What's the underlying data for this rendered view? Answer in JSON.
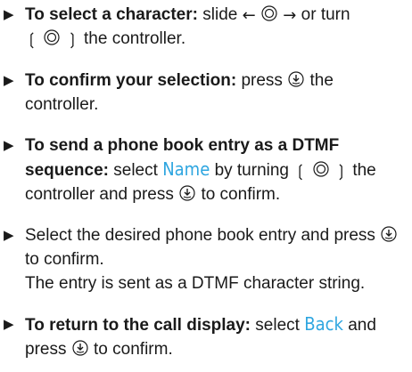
{
  "items": [
    {
      "bold": "To select a character:",
      "t1": "slide",
      "t2": "or turn",
      "t3": "the controller."
    },
    {
      "bold": "To confirm your selection:",
      "t1": "press",
      "t2": "the controller."
    },
    {
      "bold": "To send a phone book entry as a DTMF sequence:",
      "t1": "select",
      "disp": "Name",
      "t2": "by turning",
      "t3": "the controller and press",
      "t4": "to confirm."
    },
    {
      "t1": "Select the desired phone book entry and press",
      "t2": "to confirm.",
      "t3": "The entry is sent as a DTMF character string."
    },
    {
      "bold": "To return to the call display:",
      "t1": "select",
      "disp": "Back",
      "t2": "and press",
      "t3": "to confirm."
    }
  ],
  "icons": {
    "bullet": "right-pointing-triangle",
    "slide_left": "arrow-left",
    "slide_right": "arrow-right",
    "controller": "controller-ring",
    "turn_left": "turn-left-bracket",
    "turn_right": "turn-right-bracket",
    "press": "controller-press"
  },
  "colors": {
    "display_text": "#2fa6e0",
    "body_text": "#1a1a1a"
  }
}
